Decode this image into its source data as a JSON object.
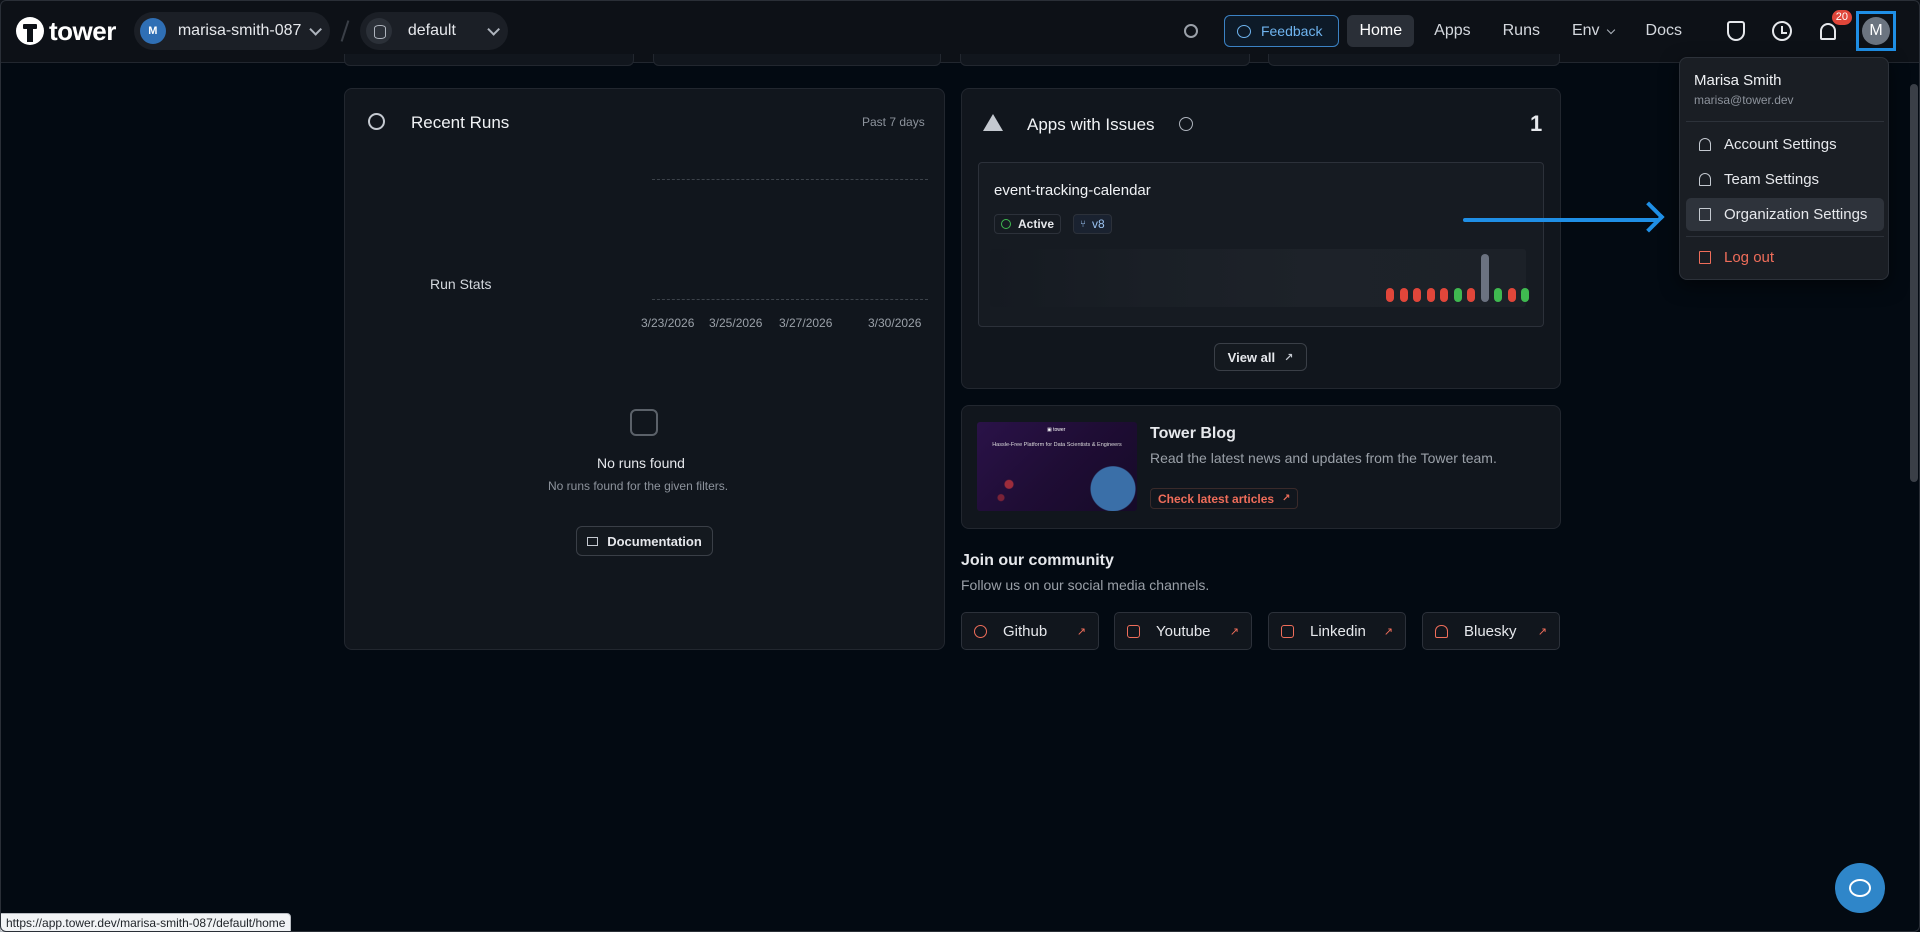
{
  "topnav": {
    "brand": "tower",
    "org": {
      "initial": "M",
      "name": "marisa-smith-087"
    },
    "environment": "default",
    "feedback_label": "Feedback",
    "links": [
      "Home",
      "Apps",
      "Runs",
      "Env",
      "Docs"
    ],
    "active_link": "Home",
    "notification_count": "20",
    "user_initial": "M"
  },
  "recent_runs": {
    "title": "Recent Runs",
    "range": "Past 7 days",
    "stats_label": "Run Stats",
    "dates": [
      "3/23/2026",
      "3/25/2026",
      "3/27/2026",
      "3/30/2026"
    ],
    "empty_title": "No runs found",
    "empty_subtitle": "No runs found for the given filters.",
    "doc_button": "Documentation"
  },
  "apps_with_issues": {
    "title": "Apps with Issues",
    "count": "1",
    "app_name": "event-tracking-calendar",
    "status": "Active",
    "version": "v8",
    "run_history": [
      "failed",
      "failed",
      "failed",
      "failed",
      "failed",
      "success",
      "failed",
      "running",
      "success",
      "failed",
      "success"
    ],
    "view_all": "View all"
  },
  "blog": {
    "image_caption": "Hassle-Free Platform for Data Scientists & Engineers",
    "title": "Tower Blog",
    "description": "Read the latest news and updates from the Tower team.",
    "link": "Check latest articles"
  },
  "community": {
    "title": "Join our community",
    "subtitle": "Follow us on our social media channels.",
    "channels": [
      "Github",
      "Youtube",
      "Linkedin",
      "Bluesky"
    ]
  },
  "user_menu": {
    "name": "Marisa Smith",
    "email": "marisa@tower.dev",
    "items": [
      "Account Settings",
      "Team Settings",
      "Organization Settings"
    ],
    "logout": "Log out"
  },
  "status_bar_url": "https://app.tower.dev/marisa-smith-087/default/home",
  "colors": {
    "accent_blue": "#1f8fe6",
    "danger": "#ef6d5a",
    "success": "#3fb950",
    "bar_fail": "#e0463a",
    "bar_running": "#6b7280"
  }
}
